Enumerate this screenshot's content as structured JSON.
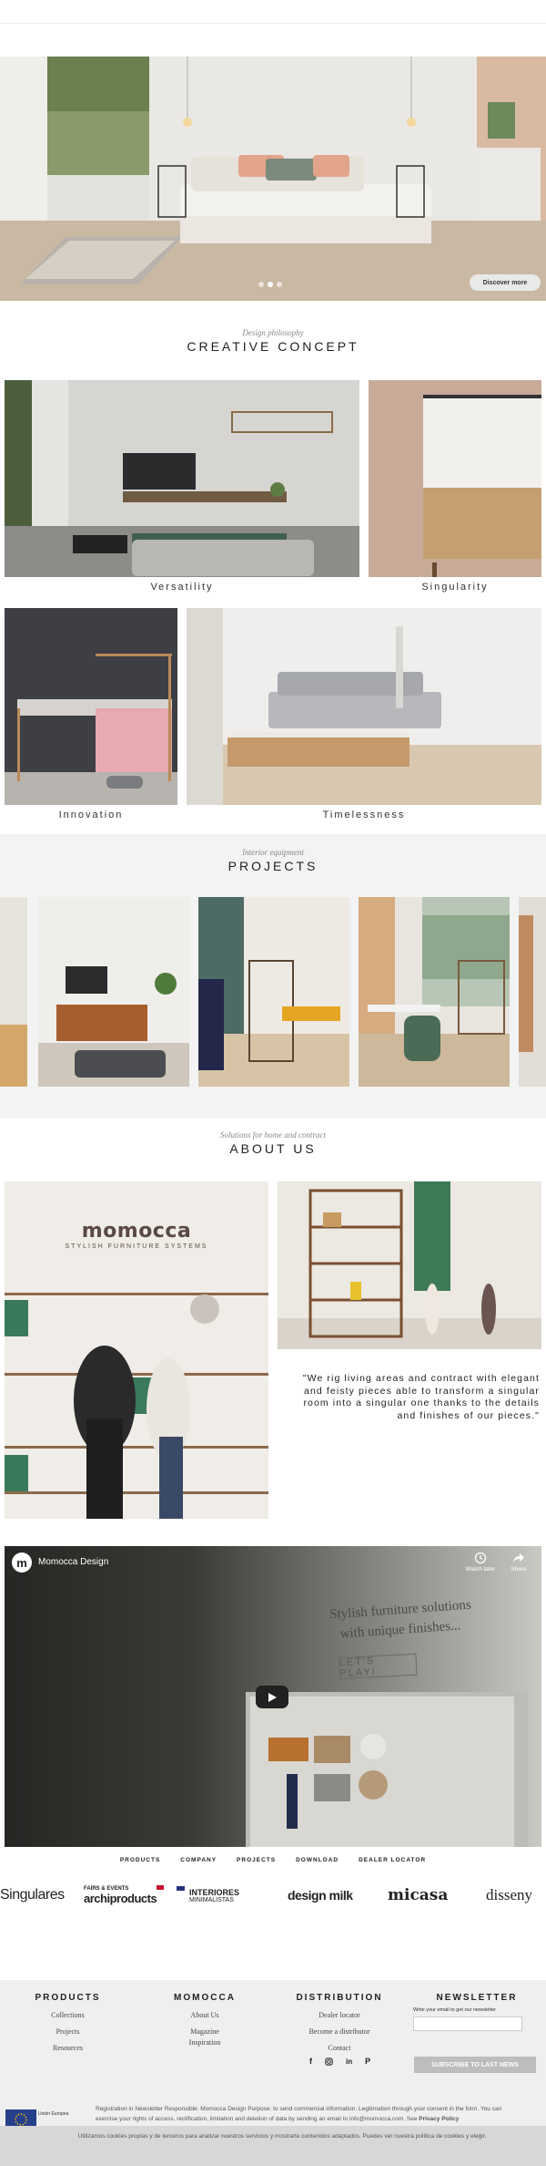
{
  "hero": {
    "discover_label": "Discover more",
    "slides": 3,
    "active_slide": 1
  },
  "creative": {
    "subtitle": "Design philosophy",
    "title": "CREATIVE CONCEPT",
    "captions": [
      "Versatility",
      "Singularity",
      "Innovation",
      "Timelessness"
    ]
  },
  "projects": {
    "subtitle": "Interior equipment",
    "title": "PROJECTS"
  },
  "about": {
    "subtitle": "Solutions for home and contract",
    "title": "ABOUT US",
    "brand": "momocca",
    "brand_tagline": "STYLISH FURNITURE SYSTEMS",
    "quote": "\"We rig living areas and contract with elegant and feisty pieces able to transform a singular room into a singular one thanks to the details and finishes of our pieces.\""
  },
  "video": {
    "channel_name": "Momocca Design",
    "watch_later": "Watch later",
    "share": "Share",
    "headline_1": "Stylish furniture solutions",
    "headline_2": "with unique finishes...",
    "cta": "LET'S PLAY!"
  },
  "nav": {
    "items": [
      "PRODUCTS",
      "COMPANY",
      "PROJECTS",
      "DOWNLOAD",
      "DEALER LOCATOR"
    ]
  },
  "press_logos": [
    "Singulares",
    "FAIRS & EVENTS",
    "archiproducts",
    "INTERIORES",
    "MINIMALISTAS",
    "design milk",
    "micasa",
    "disseny"
  ],
  "footer": {
    "products": {
      "title": "PRODUCTS",
      "links": [
        "Collections",
        "Projects",
        "Resources"
      ]
    },
    "momocca": {
      "title": "MOMOCCA",
      "links": [
        "About Us",
        "Magazine",
        "Inspiration"
      ]
    },
    "distribution": {
      "title": "DISTRIBUTION",
      "links": [
        "Dealer locator",
        "Become a distributor",
        "Contact"
      ]
    },
    "newsletter": {
      "title": "NEWSLETTER",
      "label": "Write your email to get our newsletter",
      "button": "SUBSCRIBE TO LAST NEWS"
    },
    "social": [
      "f",
      "instagram",
      "in",
      "P"
    ],
    "eu_label": "Unión Europea",
    "legal": "Registration in Newsletter Responsible: Momocca Design Purpose: to send commercial information. Legitimation through your consent in the form. You can exercise your rights of access, rectification, limitation and deletion of data by sending an email to info@momocca.com. See",
    "legal_link": "Privacy Policy"
  },
  "cookie": {
    "text": "Utilizamos cookies propias y de terceros para analizar nuestros servicios y mostrarte contenidos adaptados. Puedes ver nuestra política de cookies y elegir."
  },
  "colors": {
    "accent_green": "#2f6b4f",
    "wood": "#b9865a",
    "footer_bg": "#efefef",
    "button_bg": "#bdbdbd"
  }
}
